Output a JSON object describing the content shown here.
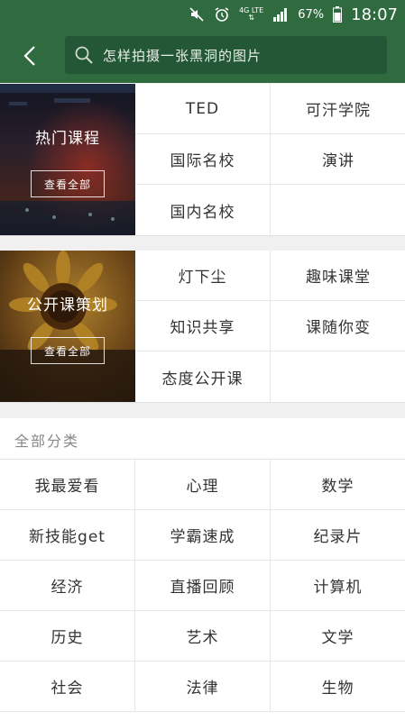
{
  "status_bar": {
    "battery": "67%",
    "time": "18:07",
    "network_top": "4G LTE",
    "network_bottom": "⇅"
  },
  "header": {
    "search_text": "怎样拍摄一张黑洞的图片"
  },
  "hot_courses": {
    "title": "热门课程",
    "view_all": "查看全部",
    "items": [
      "TED",
      "可汗学院",
      "国际名校",
      "演讲",
      "国内名校",
      ""
    ]
  },
  "open_planning": {
    "title": "公开课策划",
    "view_all": "查看全部",
    "items": [
      "灯下尘",
      "趣味课堂",
      "知识共享",
      "课随你变",
      "态度公开课",
      ""
    ]
  },
  "all_categories": {
    "title": "全部分类",
    "items": [
      "我最爱看",
      "心理",
      "数学",
      "新技能get",
      "学霸速成",
      "纪录片",
      "经济",
      "直播回顾",
      "计算机",
      "历史",
      "艺术",
      "文学",
      "社会",
      "法律",
      "生物"
    ]
  },
  "colors": {
    "brand": "#2f6b3f",
    "search_bg": "#245735"
  }
}
